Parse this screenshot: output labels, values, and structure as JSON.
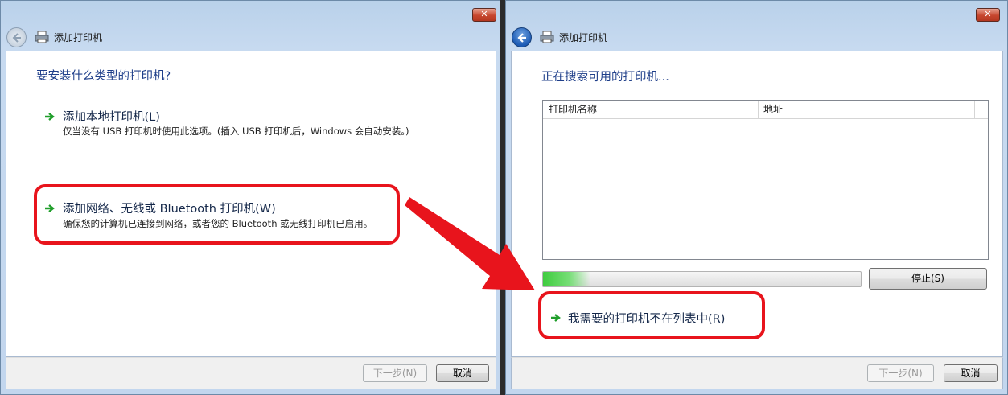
{
  "left_window": {
    "title": "添加打印机",
    "close_label": "✕",
    "heading": "要安装什么类型的打印机?",
    "options": [
      {
        "title": "添加本地打印机(L)",
        "description": "仅当没有 USB 打印机时使用此选项。(插入 USB 打印机后，Windows 会自动安装。)"
      },
      {
        "title": "添加网络、无线或 Bluetooth 打印机(W)",
        "description": "确保您的计算机已连接到网络，或者您的 Bluetooth 或无线打印机已启用。"
      }
    ],
    "next_label": "下一步(N)",
    "cancel_label": "取消"
  },
  "right_window": {
    "title": "添加打印机",
    "close_label": "✕",
    "heading": "正在搜索可用的打印机...",
    "columns": [
      "打印机名称",
      "地址"
    ],
    "progress_fraction": 0.15,
    "stop_label": "停止(S)",
    "not_listed_label": "我需要的打印机不在列表中(R)",
    "next_label": "下一步(N)",
    "cancel_label": "取消"
  },
  "colors": {
    "highlight": "#e8141c",
    "heading": "#1f3f8a",
    "progress": "#3fcc3f"
  }
}
